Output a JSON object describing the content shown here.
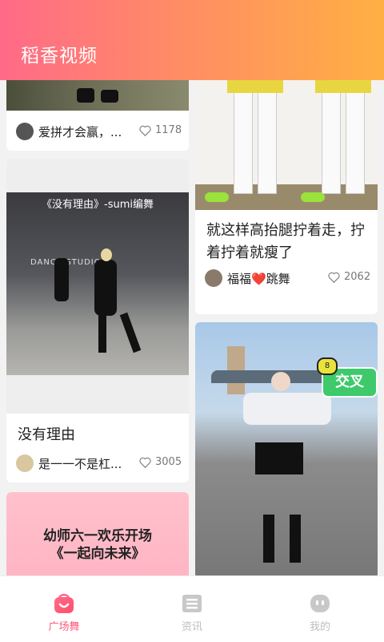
{
  "app": {
    "title": "稻香视频"
  },
  "cards": {
    "c1": {
      "author": "爱拼才会赢，...",
      "likes": "1178"
    },
    "c2": {
      "overlay": "《没有理由》-sumi编舞",
      "studio": "DANCE STUDIO",
      "title": "没有理由",
      "author": "是一一不是杠...",
      "likes": "3005"
    },
    "c3": {
      "banner_line1": "幼师六一欢乐开场",
      "banner_line2": "《一起向未来》"
    },
    "c4": {
      "title": "就这样高抬腿拧着走，拧着拧着就瘦了",
      "author": "福福❤️跳舞",
      "likes": "2062"
    },
    "c5": {
      "sticker": "交叉",
      "sticker_tag": "8"
    }
  },
  "tabs": [
    {
      "label": "广场舞",
      "active": true
    },
    {
      "label": "资讯",
      "active": false
    },
    {
      "label": "我的",
      "active": false
    }
  ],
  "colors": {
    "accent": "#ff5c7a",
    "inactive": "#bdbdbd"
  }
}
